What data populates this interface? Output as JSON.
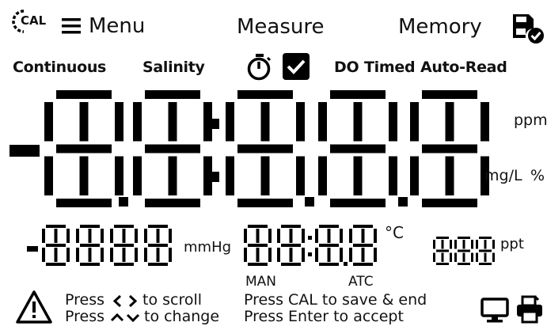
{
  "header": {
    "cal_label": "CAL",
    "menu_label": "Menu",
    "measure_label": "Measure",
    "memory_label": "Memory"
  },
  "modes": {
    "continuous": "Continuous",
    "salinity": "Salinity",
    "do_label": "DO",
    "timed": "Timed",
    "auto_read": "Auto-Read",
    "checkbox_checked": true
  },
  "main_display": {
    "sign": "-",
    "digits": "8888.8",
    "units": {
      "ppm": "ppm",
      "mgl": "mg/L",
      "percent": "%"
    }
  },
  "pressure_display": {
    "sign": "-",
    "digits": "8888",
    "unit": "mmHg"
  },
  "temperature_display": {
    "digits": "888.8",
    "unit": "°C",
    "man": "MAN",
    "atc": "ATC"
  },
  "salinity_display": {
    "digits": "888",
    "unit": "ppt"
  },
  "instructions": {
    "scroll_prefix": "Press",
    "scroll_suffix": "to scroll",
    "change_prefix": "Press",
    "change_suffix": "to change",
    "cal_save": "Press CAL to save & end",
    "enter_accept": "Press Enter to accept"
  },
  "colors": {
    "background": "#ffffff",
    "foreground": "#000000"
  },
  "icons": [
    "cal-icon",
    "menu-icon",
    "save-memory-icon",
    "timer-icon",
    "checkbox-icon",
    "warning-icon",
    "scroll-arrows-icon",
    "change-arrows-icon",
    "computer-icon",
    "printer-icon"
  ]
}
